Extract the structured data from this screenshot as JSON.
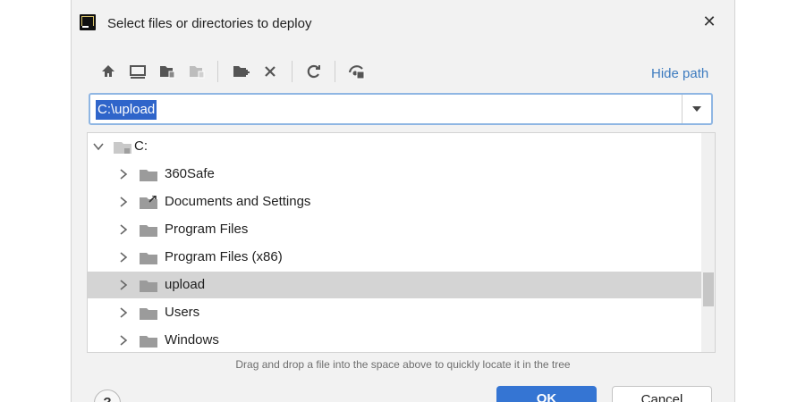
{
  "dialog": {
    "title": "Select files or directories to deploy",
    "close_glyph": "✕",
    "app_icon": "intellij-app-icon"
  },
  "toolbar": {
    "buttons": [
      {
        "icon": "home-icon"
      },
      {
        "icon": "desktop-icon"
      },
      {
        "icon": "project-folder-icon"
      },
      {
        "icon": "module-folder-icon"
      },
      {
        "icon": "new-folder-icon"
      },
      {
        "icon": "delete-icon"
      },
      {
        "icon": "refresh-icon"
      },
      {
        "icon": "show-hidden-icon"
      }
    ],
    "hide_path_label": "Hide path",
    "accent_color": "#3d7bbf"
  },
  "path": {
    "value": "C:\\upload"
  },
  "tree": {
    "root_label": "C:",
    "items": [
      {
        "label": "360Safe",
        "type": "folder"
      },
      {
        "label": "Documents and Settings",
        "type": "shortcut-folder"
      },
      {
        "label": "Program Files",
        "type": "folder"
      },
      {
        "label": "Program Files (x86)",
        "type": "folder"
      },
      {
        "label": "upload",
        "type": "folder",
        "selected": true
      },
      {
        "label": "Users",
        "type": "folder"
      },
      {
        "label": "Windows",
        "type": "folder"
      }
    ]
  },
  "hint_text": "Drag and drop a file into the space above to quickly locate it in the tree",
  "footer": {
    "help_label": "?",
    "ok_label": "OK",
    "cancel_label": "Cancel",
    "ok_color": "#3575d3"
  }
}
